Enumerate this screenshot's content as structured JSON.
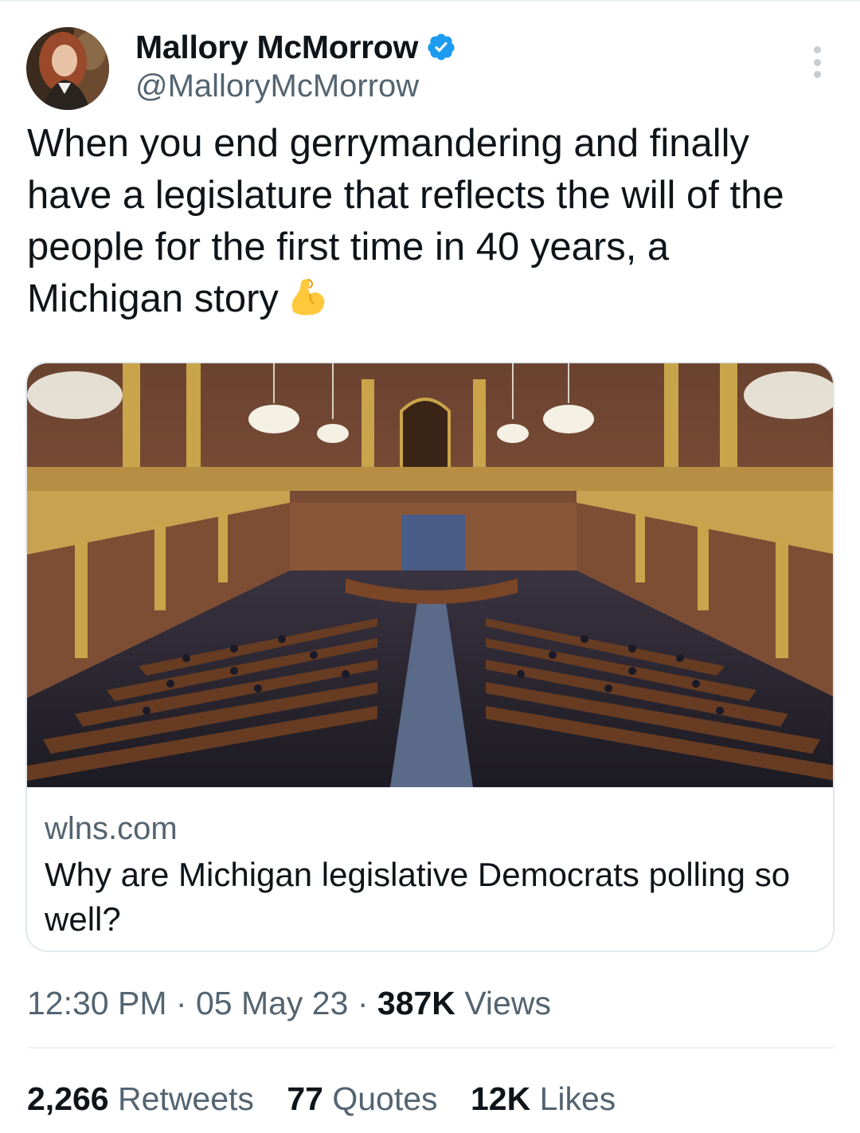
{
  "author": {
    "display_name": "Mallory McMorrow",
    "handle": "@MalloryMcMorrow",
    "verified": true
  },
  "tweet": {
    "text": "When you end gerrymandering and finally have a legislature that reflects the will of the people for the first time in 40 years, a Michigan story",
    "emoji": "flexed-biceps"
  },
  "link_card": {
    "domain": "wlns.com",
    "title": "Why are Michigan legislative Democrats polling so well?"
  },
  "meta": {
    "time": "12:30 PM",
    "date": "05 May 23",
    "separator": "·",
    "views_count": "387K",
    "views_label": "Views"
  },
  "stats": [
    {
      "count": "2,266",
      "label": "Retweets"
    },
    {
      "count": "77",
      "label": "Quotes"
    },
    {
      "count": "12K",
      "label": "Likes"
    }
  ],
  "colors": {
    "verified_badge": "#1d9bf0",
    "secondary_text": "#536471",
    "primary_text": "#0f1419"
  }
}
